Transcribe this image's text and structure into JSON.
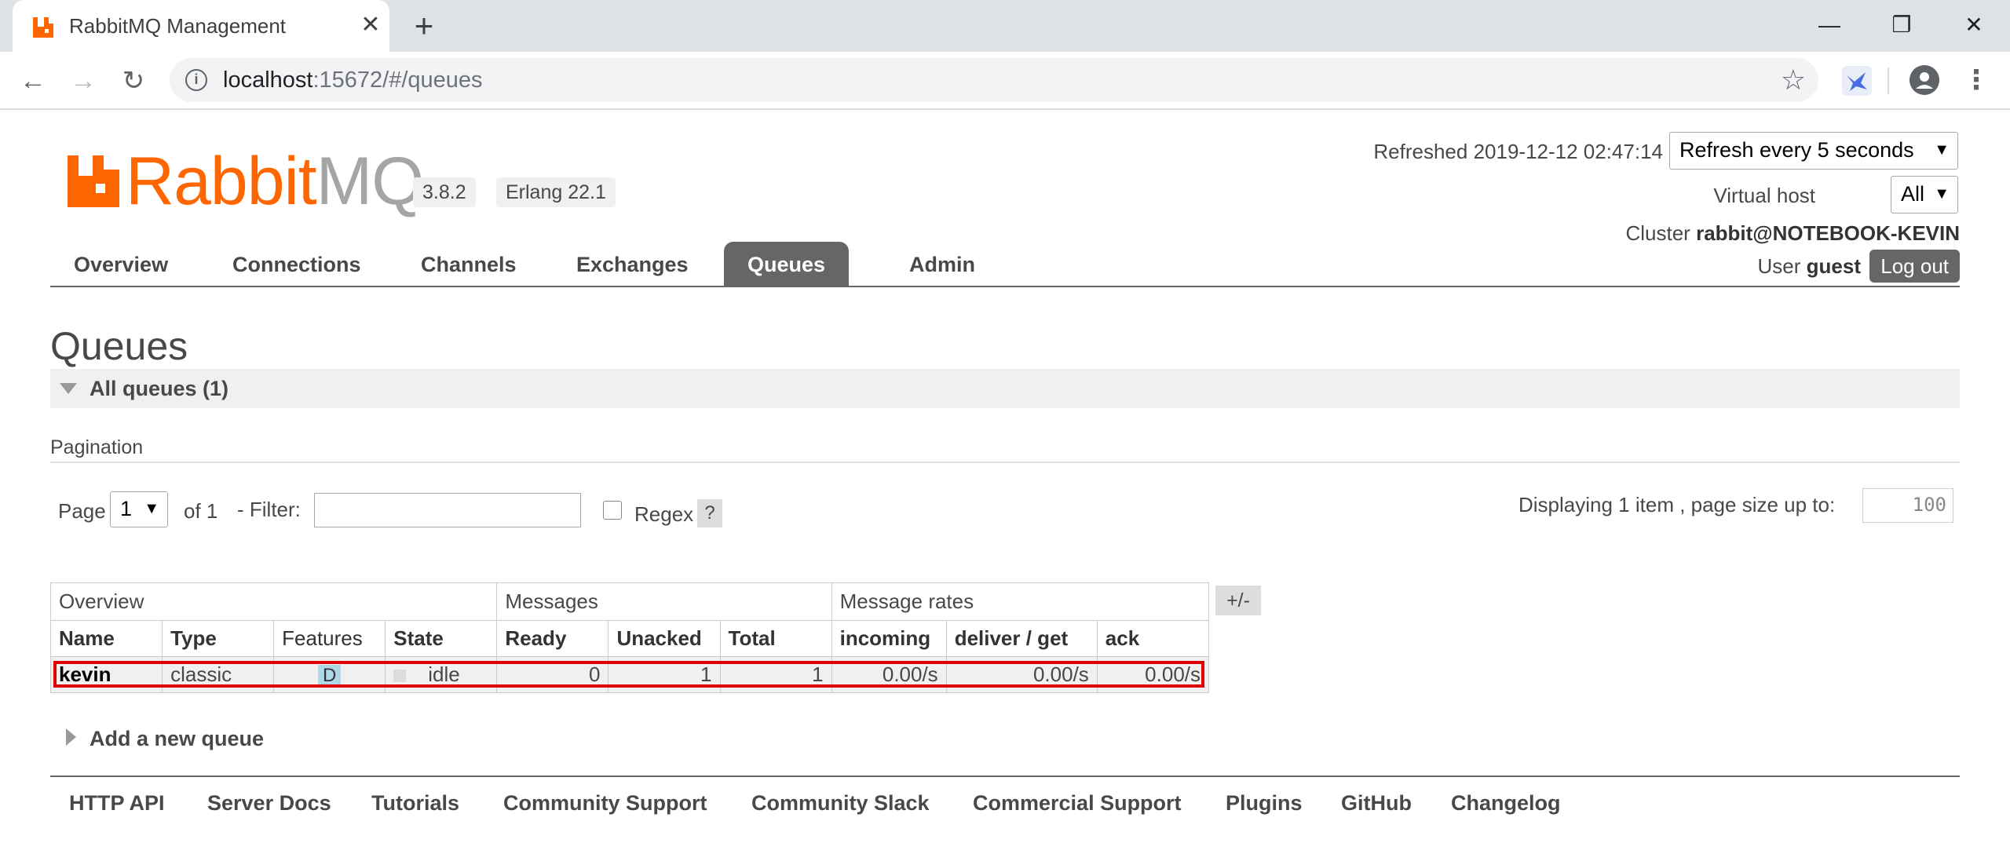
{
  "browser": {
    "tab_title": "RabbitMQ Management",
    "tab_close": "✕",
    "new_tab": "+",
    "url_host": "localhost",
    "url_rest": ":15672/#/queues",
    "window_controls": [
      "—",
      "❐",
      "✕"
    ]
  },
  "header": {
    "logo_rabbit": "Rabbit",
    "logo_mq": "MQ",
    "version": "3.8.2",
    "erlang": "Erlang 22.1",
    "refreshed": "Refreshed 2019-12-12 02:47:14",
    "refresh_select": "Refresh every 5 seconds",
    "vhost_label": "Virtual host",
    "vhost_value": "All",
    "cluster_label": "Cluster",
    "cluster_value": "rabbit@NOTEBOOK-KEVIN",
    "user_label": "User",
    "user_value": "guest",
    "logout": "Log out"
  },
  "nav": {
    "items": [
      "Overview",
      "Connections",
      "Channels",
      "Exchanges",
      "Queues",
      "Admin"
    ],
    "active": "Queues"
  },
  "main": {
    "title": "Queues",
    "section": "All queues (1)",
    "pagination_label": "Pagination",
    "page_label": "Page",
    "page_value": "1",
    "of_label": "of 1",
    "filter_label": "- Filter:",
    "regex_label": "Regex",
    "help": "?",
    "displaying": "Displaying 1 item , page size up to:",
    "page_size": "100",
    "plus_minus": "+/-",
    "add_queue": "Add a new queue"
  },
  "table": {
    "groups": [
      "Overview",
      "Messages",
      "Message rates"
    ],
    "columns": [
      "Name",
      "Type",
      "Features",
      "State",
      "Ready",
      "Unacked",
      "Total",
      "incoming",
      "deliver / get",
      "ack"
    ],
    "rows": [
      {
        "name": "kevin",
        "type": "classic",
        "features": "D",
        "state": "idle",
        "ready": "0",
        "unacked": "1",
        "total": "1",
        "incoming": "0.00/s",
        "deliver_get": "0.00/s",
        "ack": "0.00/s"
      }
    ]
  },
  "footer": {
    "links": [
      "HTTP API",
      "Server Docs",
      "Tutorials",
      "Community Support",
      "Community Slack",
      "Commercial Support",
      "Plugins",
      "GitHub",
      "Changelog"
    ]
  },
  "colors": {
    "brand_orange": "#ff6600",
    "nav_active": "#666666",
    "highlight_red": "#e00000"
  }
}
